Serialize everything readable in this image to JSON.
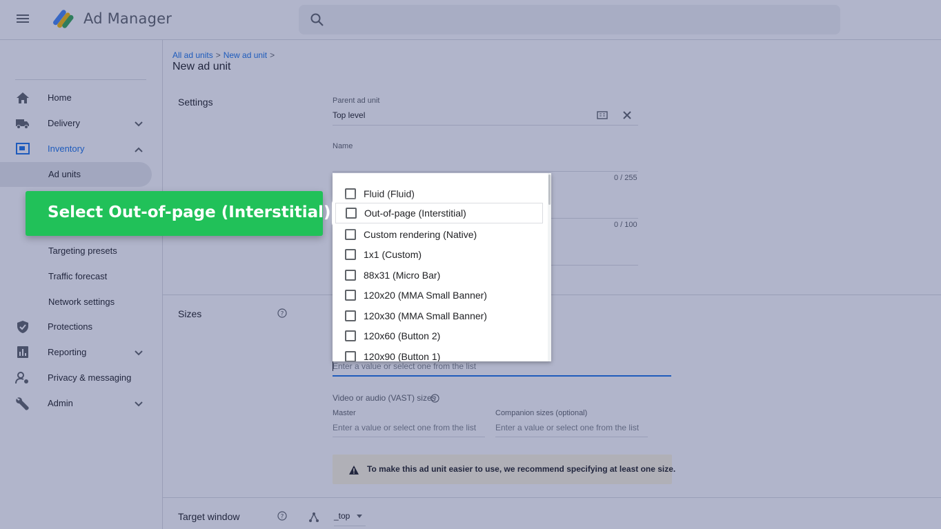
{
  "app": {
    "title": "Ad Manager"
  },
  "search": {
    "placeholder": ""
  },
  "sidebar": {
    "items": [
      {
        "label": "Home",
        "icon": "home-icon"
      },
      {
        "label": "Delivery",
        "icon": "truck-icon"
      },
      {
        "label": "Inventory",
        "icon": "inventory-icon"
      },
      {
        "label": "Protections",
        "icon": "shield-icon"
      },
      {
        "label": "Reporting",
        "icon": "bar-chart-icon"
      },
      {
        "label": "Privacy & messaging",
        "icon": "person-settings-icon"
      },
      {
        "label": "Admin",
        "icon": "wrench-icon"
      }
    ],
    "inventory_sub": [
      {
        "label": "Ad units"
      },
      {
        "label": "Targeting presets"
      },
      {
        "label": "Traffic forecast"
      },
      {
        "label": "Network settings"
      }
    ]
  },
  "breadcrumb": {
    "items": [
      "All ad units",
      "New ad unit"
    ],
    "separator": ">"
  },
  "page": {
    "title": "New ad unit"
  },
  "settings": {
    "title": "Settings",
    "parent_label": "Parent ad unit",
    "parent_value": "Top level",
    "name_label": "Name",
    "name_counter": "0 / 255",
    "desc_counter": "0 / 100"
  },
  "sizes": {
    "title": "Sizes",
    "input_placeholder": "Enter a value or select one from the list",
    "dropdown_options": [
      "Fluid (Fluid)",
      "Out-of-page (Interstitial)",
      "Custom rendering (Native)",
      "1x1 (Custom)",
      "88x31 (Micro Bar)",
      "120x20 (MMA Small Banner)",
      "120x30 (MMA Small Banner)",
      "120x60 (Button 2)",
      "120x90 (Button 1)"
    ],
    "vast_label": "Video or audio (VAST) sizes",
    "master_label": "Master",
    "master_placeholder": "Enter a value or select one from the list",
    "companion_label": "Companion sizes (optional)",
    "companion_placeholder": "Enter a value or select one from the list",
    "warning": "To make this ad unit easier to use, we recommend specifying at least one size."
  },
  "target_window": {
    "title": "Target window",
    "value": "_top"
  },
  "callout": {
    "text": "Select Out-of-page (Interstitial)"
  },
  "colors": {
    "accent": "#1a73e8",
    "callout": "#21c159",
    "warning_bg": "#fef7e0"
  }
}
